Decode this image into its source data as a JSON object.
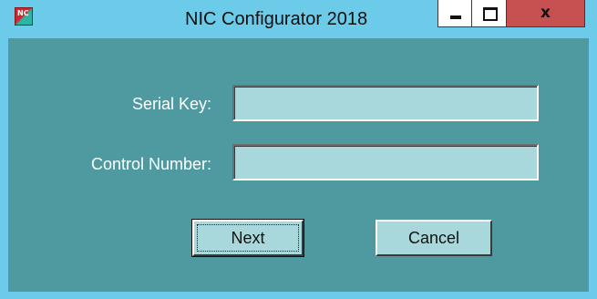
{
  "window": {
    "title": "NIC Configurator 2018",
    "icon": "nic-app-icon",
    "icon_text": "NC",
    "controls": {
      "minimize": "minimize-icon",
      "maximize": "maximize-icon",
      "close": "close-icon",
      "close_glyph": "x"
    }
  },
  "form": {
    "serial_key_label": "Serial Key:",
    "serial_key_value": "",
    "control_number_label": "Control Number:",
    "control_number_value": ""
  },
  "buttons": {
    "next_label": "Next",
    "cancel_label": "Cancel"
  },
  "colors": {
    "titlebar": "#6ccbe9",
    "client_background": "#4e9aa0",
    "field_background": "#a9d8dc",
    "close_button": "#c75050"
  }
}
